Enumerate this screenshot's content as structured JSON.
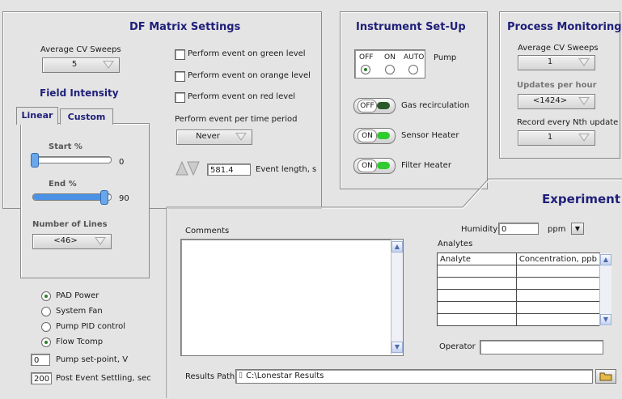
{
  "df_matrix": {
    "title": "DF Matrix Settings",
    "avg_cv_label": "Average CV Sweeps",
    "avg_cv_value": "5",
    "field_intensity_title": "Field Intensity",
    "tabs": [
      "Linear",
      "Custom"
    ],
    "start_label": "Start %",
    "start_value": "0",
    "start_fraction": 0.0,
    "end_label": "End %",
    "end_value": "90",
    "end_fraction": 0.9,
    "lines_label": "Number of Lines",
    "lines_value": "<46>",
    "events": [
      "Perform event on green level",
      "Perform event on orange level",
      "Perform event on red level"
    ],
    "period_label": "Perform event per time period",
    "period_value": "Never",
    "event_length_value": "581.4",
    "event_length_label": "Event length, s"
  },
  "instrument": {
    "title": "Instrument Set-Up",
    "pump_options": [
      "OFF",
      "ON",
      "AUTO"
    ],
    "pump_label": "Pump",
    "pump_selected": "OFF",
    "toggles": [
      {
        "state": "OFF",
        "label": "Gas recirculation",
        "led": "#2a5a2a"
      },
      {
        "state": "ON",
        "label": "Sensor Heater",
        "led": "#2ecc2e"
      },
      {
        "state": "ON",
        "label": "Filter Heater",
        "led": "#2ecc2e"
      }
    ]
  },
  "process": {
    "title": "Process Monitoring",
    "avg_cv_label": "Average CV Sweeps",
    "avg_cv_value": "1",
    "updates_label": "Updates per hour",
    "updates_value": "<1424>",
    "record_label": "Record every Nth update",
    "record_value": "1"
  },
  "left_options": {
    "radios": [
      {
        "label": "PAD Power",
        "selected": true
      },
      {
        "label": "System Fan",
        "selected": false
      },
      {
        "label": "Pump PID control",
        "selected": false
      },
      {
        "label": "Flow Tcomp",
        "selected": true
      }
    ],
    "setpoint_value": "0",
    "setpoint_label": "Pump set-point, V",
    "settling_value": "200",
    "settling_label": "Post Event Settling, sec"
  },
  "experiment": {
    "title": "Experiment",
    "comments_label": "Comments",
    "humidity_label": "Humidity",
    "humidity_value": "0",
    "humidity_unit": "ppm",
    "analytes_label": "Analytes",
    "analytes_headers": [
      "Analyte",
      "Concentration, ppb"
    ],
    "operator_label": "Operator",
    "results_label": "Results Path",
    "results_value": "C:\\Lonestar Results"
  },
  "colors": {
    "title": "#1f1f7a",
    "led_on": "#2ecc2e",
    "slider": "#4b92e6"
  }
}
